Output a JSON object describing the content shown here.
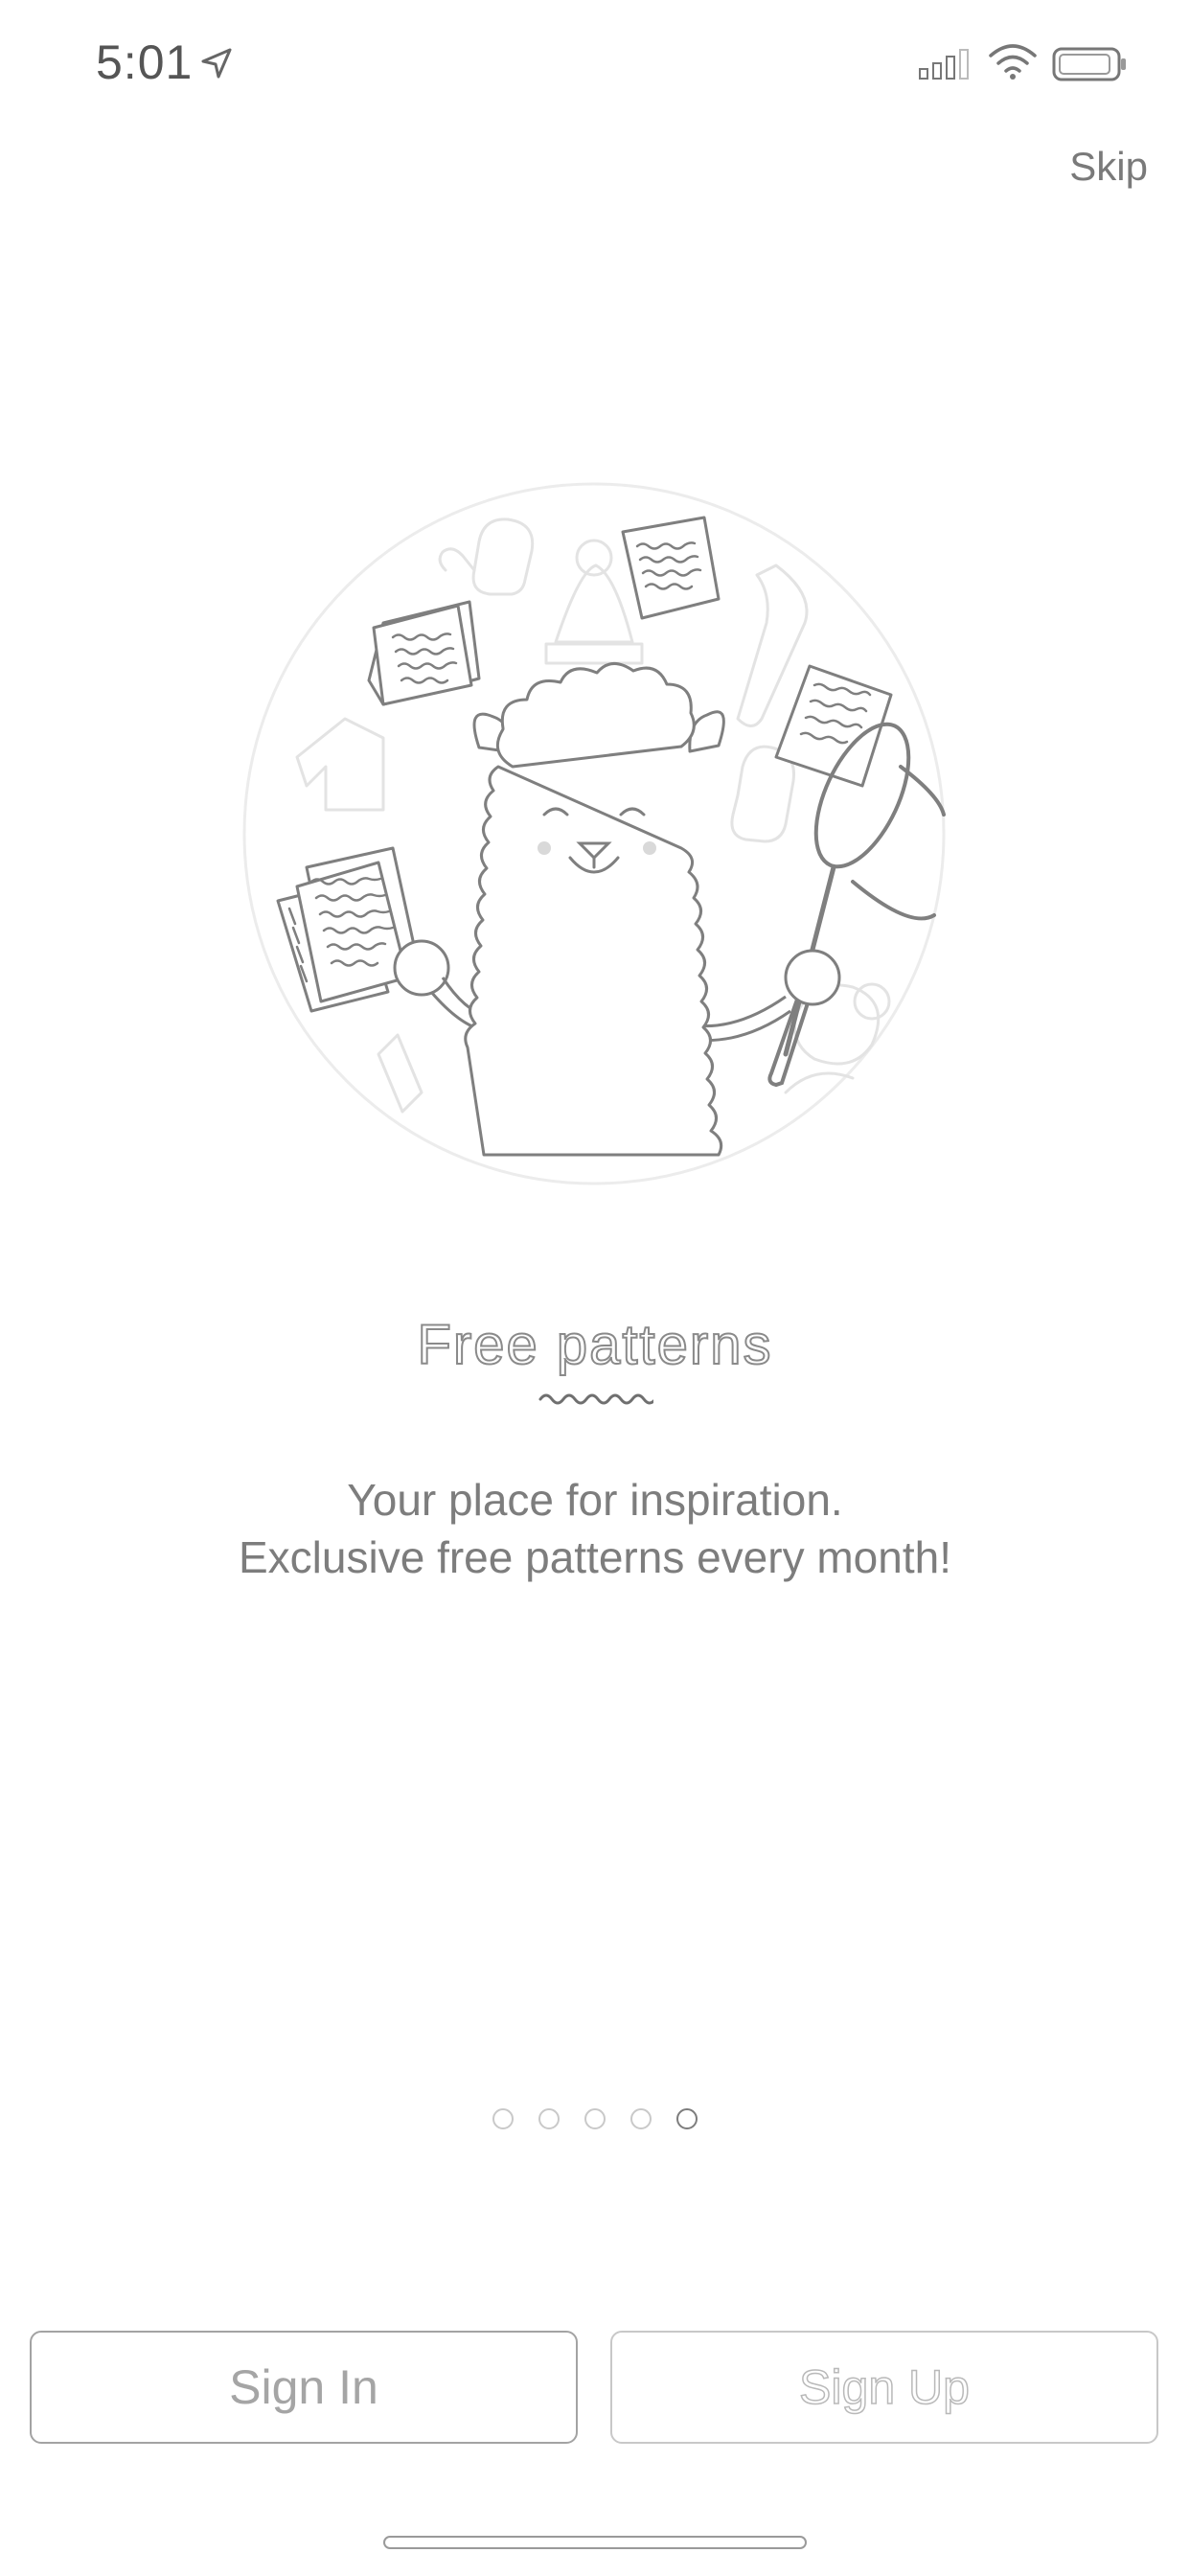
{
  "status_bar": {
    "time": "5:01",
    "location_icon": "location-arrow-icon",
    "signal_icon": "cellular-signal-icon",
    "wifi_icon": "wifi-icon",
    "battery_icon": "battery-icon"
  },
  "header": {
    "skip_label": "Skip"
  },
  "onboarding": {
    "illustration_icon": "llama-juggling-patterns-illustration",
    "title": "Free patterns",
    "description_line1": "Your place for inspiration.",
    "description_line2": "Exclusive free patterns every month!",
    "page_count": 5,
    "active_page": 5
  },
  "actions": {
    "sign_in_label": "Sign In",
    "sign_up_label": "Sign Up"
  },
  "colors": {
    "text_gray": "#7d7d7d",
    "line_gray": "#8a8a8a",
    "light_border": "#c8c8c8"
  }
}
